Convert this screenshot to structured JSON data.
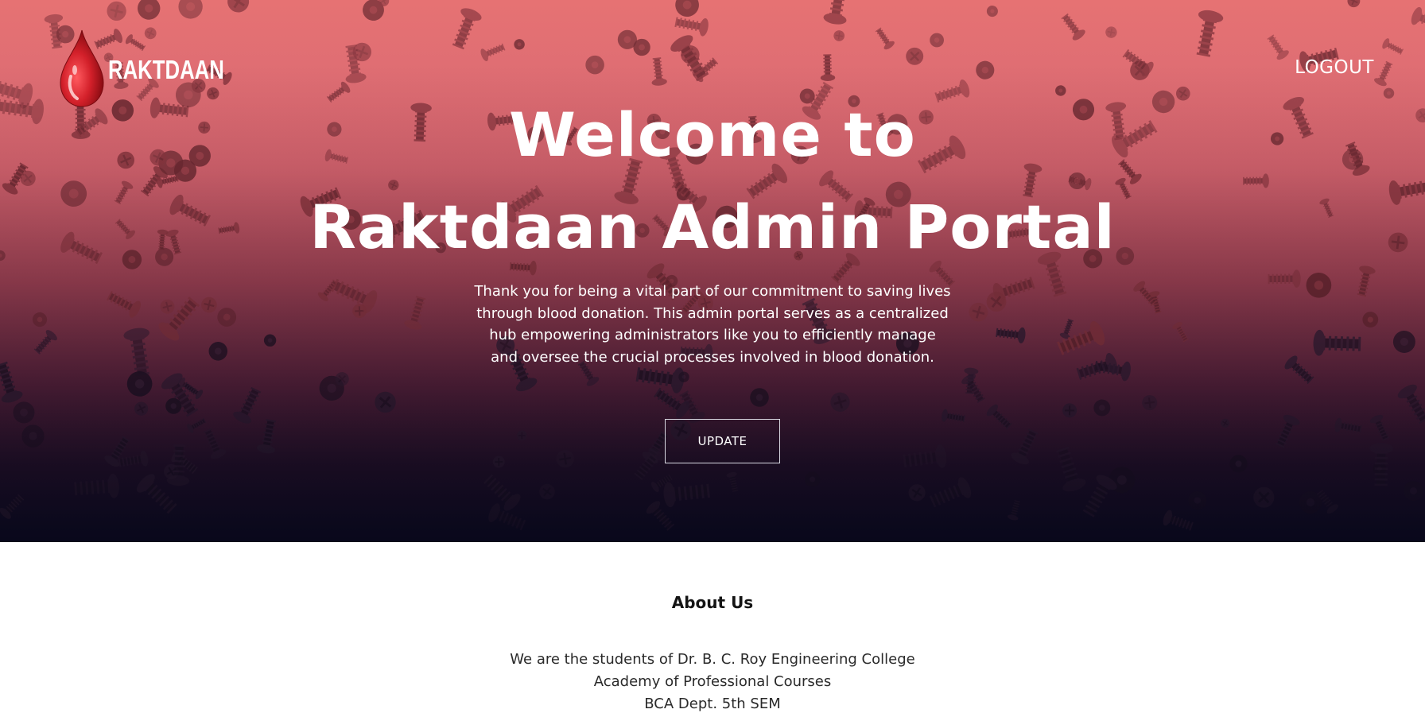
{
  "brand": {
    "name": "RAKTDAAN",
    "accent_color": "#d3202a",
    "icon": "blood-drop-icon"
  },
  "nav": {
    "logout_label": "LOGOUT"
  },
  "hero": {
    "headline_line1": "Welcome to",
    "headline_line2": "Raktdaan Admin Portal",
    "intro_text": "Thank you for being a vital part of our commitment to saving lives through blood donation. This admin portal serves as a centralized hub empowering administrators like you to efficiently manage and oversee the crucial processes involved in blood donation.",
    "update_label": "UPDATE",
    "gradient_top_color": "#e57373",
    "gradient_bottom_color": "#0b0b1f"
  },
  "about": {
    "title": "About Us",
    "lines": [
      "We are the students of Dr. B. C. Roy Engineering College",
      "Academy of Professional Courses",
      "BCA Dept. 5th SEM"
    ]
  }
}
